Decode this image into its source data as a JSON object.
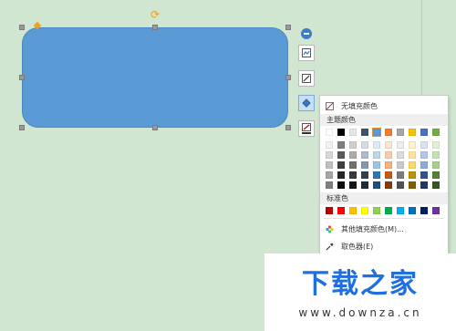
{
  "colors": {
    "canvas": "#d0e6d0",
    "shape_fill": "#5b9bd5",
    "accent": "#3c7cc7",
    "handle": "#9a9a9a",
    "adjust_handle": "#f0a020"
  },
  "side_toolbar": {
    "buttons": [
      {
        "icon": "layout-icon"
      },
      {
        "icon": "outline-pen-icon"
      },
      {
        "icon": "fill-bucket-icon",
        "active": true
      },
      {
        "icon": "line-color-icon"
      }
    ]
  },
  "fill_menu": {
    "no_fill_label": "无填充颜色",
    "theme_colors_title": "主题颜色",
    "standard_colors_title": "标准色",
    "more_colors_label": "其他填充颜色(M)...",
    "eyedropper_label": "取色器(E)",
    "theme_base": [
      "#ffffff",
      "#000000",
      "#e7e6e6",
      "#44546a",
      "#5b9bd5",
      "#ed7d31",
      "#a5a5a5",
      "#ffc000",
      "#4472c4",
      "#70ad47"
    ],
    "theme_shades": [
      [
        "#f2f2f2",
        "#7f7f7f",
        "#d0cece",
        "#d6dce4",
        "#deebf6",
        "#fbe5d5",
        "#ededed",
        "#fff2cc",
        "#d9e2f3",
        "#e2efd9"
      ],
      [
        "#d8d8d8",
        "#595959",
        "#aeaaaa",
        "#adb9ca",
        "#bdd7ee",
        "#f7cbac",
        "#dbdbdb",
        "#fee599",
        "#b4c6e7",
        "#c5e0b3"
      ],
      [
        "#bfbfbf",
        "#3f3f3f",
        "#757070",
        "#8496b0",
        "#9dc3e6",
        "#f4b183",
        "#c9c9c9",
        "#ffd966",
        "#8eaadb",
        "#a8d08d"
      ],
      [
        "#a5a5a5",
        "#262626",
        "#3a3838",
        "#323f4f",
        "#2e75b5",
        "#c55a11",
        "#7b7b7b",
        "#bf9000",
        "#2f5496",
        "#538135"
      ],
      [
        "#7f7f7f",
        "#0c0c0c",
        "#171616",
        "#222a35",
        "#1e4e79",
        "#833c0b",
        "#525252",
        "#7f6000",
        "#1f3864",
        "#375623"
      ]
    ],
    "standard": [
      "#c00000",
      "#ff0000",
      "#ffc000",
      "#ffff00",
      "#92d050",
      "#00b050",
      "#00b0f0",
      "#0070c0",
      "#002060",
      "#7030a0"
    ]
  },
  "watermark": {
    "title": "下载之家",
    "url": "www.downza.cn"
  }
}
